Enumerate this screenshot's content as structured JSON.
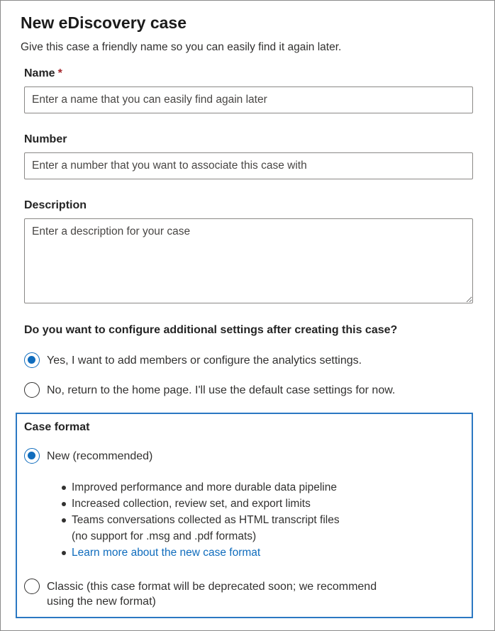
{
  "dialog": {
    "title": "New eDiscovery case",
    "subtitle": "Give this case a friendly name so you can easily find it again later."
  },
  "fields": {
    "name": {
      "label": "Name",
      "required_marker": "*",
      "value": "",
      "placeholder": "Enter a name that you can easily find again later"
    },
    "number": {
      "label": "Number",
      "value": "",
      "placeholder": "Enter a number that you want to associate this case with"
    },
    "description": {
      "label": "Description",
      "value": "",
      "placeholder": "Enter a description for your case"
    }
  },
  "additional_settings": {
    "question": "Do you want to configure additional settings after creating this case?",
    "options": [
      {
        "label": "Yes, I want to add members or configure the analytics settings.",
        "checked": true
      },
      {
        "label": "No, return to the home page. I'll use the default case settings for now.",
        "checked": false
      }
    ]
  },
  "case_format": {
    "title": "Case format",
    "new_option": {
      "label": "New (recommended)",
      "checked": true
    },
    "bullets": [
      "Improved performance and more durable data pipeline",
      "Increased collection, review set, and export limits",
      "Teams conversations collected as HTML transcript files",
      "(no support for .msg and .pdf formats)"
    ],
    "learn_more_link": "Learn more about the new case format",
    "classic_option": {
      "label_line1": "Classic (this case format will be deprecated soon; we recommend",
      "label_line2": "using the new format)",
      "checked": false
    }
  },
  "colors": {
    "accent": "#0f6cbd",
    "required": "#a4262c",
    "case_box_border": "#2b78c2"
  }
}
